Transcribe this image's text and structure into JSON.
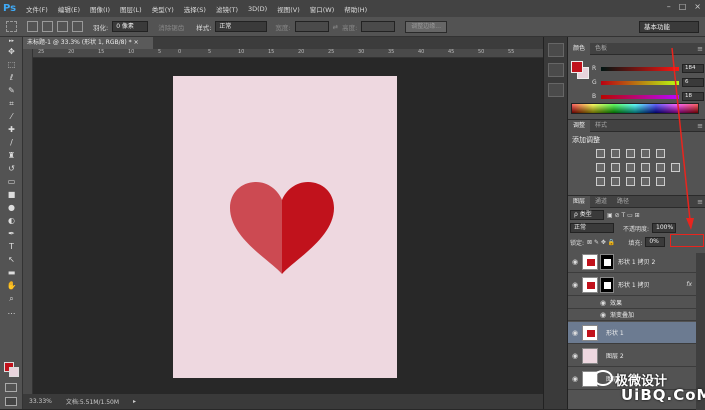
{
  "menubar": {
    "logo": "Ps",
    "items": [
      "文件(F)",
      "编辑(E)",
      "图像(I)",
      "图层(L)",
      "类型(Y)",
      "选择(S)",
      "滤镜(T)",
      "3D(D)",
      "视图(V)",
      "窗口(W)",
      "帮助(H)"
    ],
    "window_controls": [
      "–",
      "□",
      "×"
    ]
  },
  "options": {
    "feather_label": "羽化:",
    "feather_value": "0 像素",
    "antialias": "消除锯齿",
    "style_label": "样式:",
    "style_value": "正常",
    "width_label": "宽度:",
    "height_label": "高度:",
    "refine_edge": "调整边缘...",
    "workspace": "基本功能"
  },
  "document": {
    "tab_title": "未标题-1 @ 33.3% (形状 1, RGB/8) *",
    "canvas_color": "#eed8e0",
    "heart_left_color": "#cc4a52",
    "heart_right_color": "#c1121c",
    "ruler_ticks": [
      "25",
      "20",
      "15",
      "10",
      "5",
      "0",
      "5",
      "10",
      "15",
      "20",
      "25",
      "30",
      "35",
      "40",
      "45",
      "50",
      "55"
    ]
  },
  "status": {
    "zoom": "33.33%",
    "doc_size": "文档:5.51M/1.50M"
  },
  "color_panel": {
    "tabs": [
      "颜色",
      "色板"
    ],
    "r_label": "R",
    "r_value": "184",
    "g_label": "G",
    "g_value": "6",
    "b_label": "B",
    "b_value": "18",
    "foreground": "#c1121c"
  },
  "adjust_panel": {
    "tabs": [
      "调整",
      "样式"
    ],
    "title": "添加调整"
  },
  "layers_panel": {
    "tabs": [
      "图层",
      "通道",
      "路径"
    ],
    "filter_kind": "ρ 类型",
    "blend_mode": "正常",
    "opacity_label": "不透明度:",
    "opacity_value": "100%",
    "lock_label": "锁定:",
    "fill_label": "填充:",
    "fill_value": "0%",
    "layers": [
      {
        "name": "形状 1 拷贝 2",
        "fx": ""
      },
      {
        "name": "形状 1 拷贝",
        "fx": "fx"
      },
      {
        "name": "效果",
        "fx": ""
      },
      {
        "name": "渐变叠加",
        "fx": ""
      },
      {
        "name": "形状 1",
        "fx": ""
      },
      {
        "name": "图层 2",
        "fx": ""
      },
      {
        "name": "图层",
        "fx": ""
      }
    ]
  },
  "watermark": {
    "text": "极微设计",
    "site": "UiBQ.CoM"
  }
}
